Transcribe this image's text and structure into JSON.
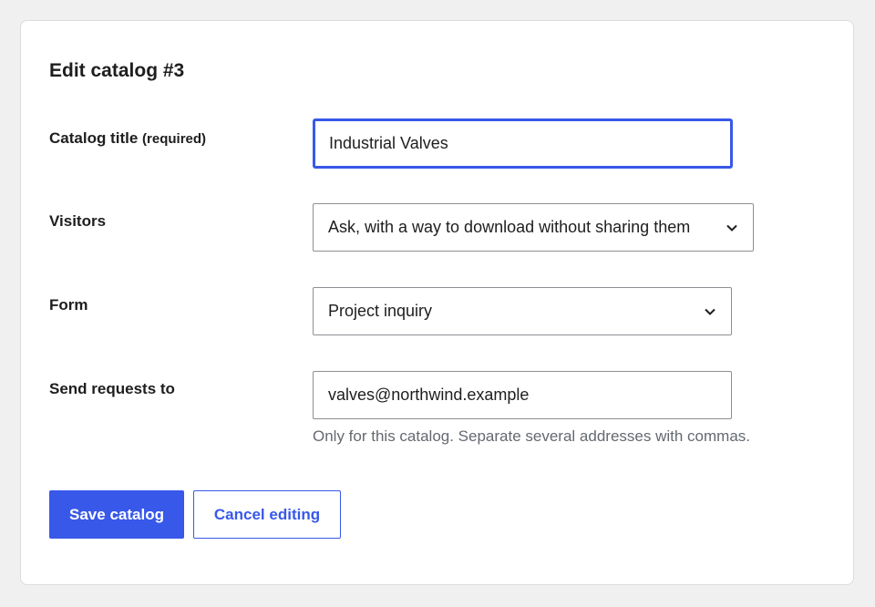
{
  "form": {
    "heading": "Edit catalog #3",
    "fields": {
      "title": {
        "label": "Catalog title",
        "required_note": "(required)",
        "value": "Industrial Valves"
      },
      "visitors": {
        "label": "Visitors",
        "selected": "Ask, with a way to download without sharing them"
      },
      "form_select": {
        "label": "Form",
        "selected": "Project inquiry"
      },
      "send_to": {
        "label": "Send requests to",
        "value": "valves@northwind.example",
        "help": "Only for this catalog. Separate several addresses with commas."
      }
    },
    "actions": {
      "save_label": "Save catalog",
      "cancel_label": "Cancel editing"
    }
  },
  "colors": {
    "accent": "#3858e9",
    "background": "#f0f0f0",
    "card": "#ffffff",
    "help_text": "#646970"
  },
  "icons": {
    "select_arrow": "chevron-down-icon"
  }
}
